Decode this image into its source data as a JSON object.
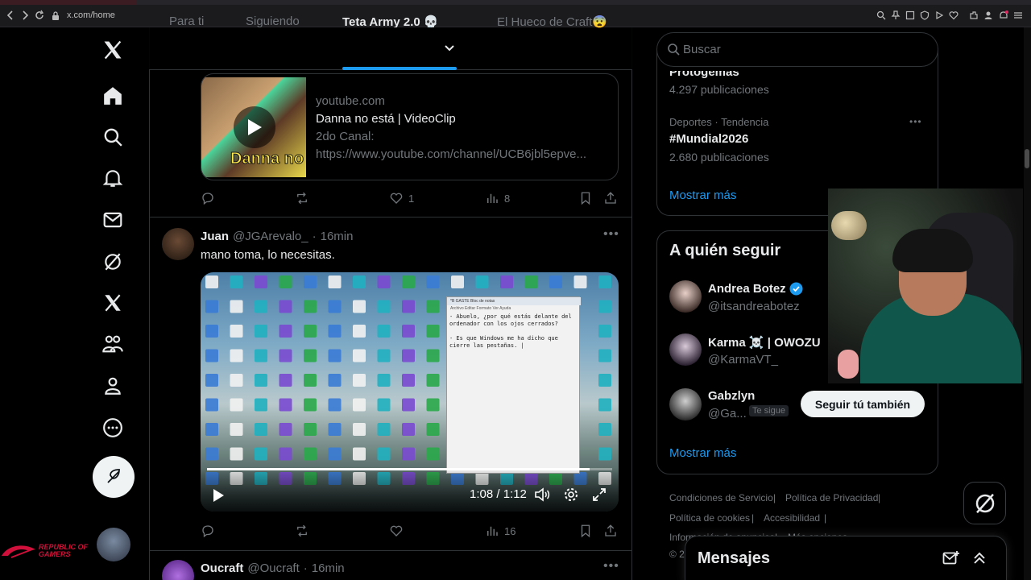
{
  "browser": {
    "url": "x.com/home"
  },
  "tabs": {
    "items": [
      "Para ti",
      "Siguiendo",
      "Teta Army 2.0 💀",
      "El Hueco de Craft😨"
    ]
  },
  "card": {
    "domain": "youtube.com",
    "title": "Danna no está | VideoClip",
    "desc_line1": "2do Canal:",
    "desc_line2": "https://www.youtube.com/channel/UCB6jbl5epve...",
    "thumb_text": "Danna no",
    "likes": "1",
    "views": "8"
  },
  "tweet1": {
    "name": "Juan",
    "handle": "@JGArevalo_",
    "time": "16min",
    "text": "mano toma, lo necesitas.",
    "views": "16",
    "video": {
      "time": "1:08 / 1:12",
      "progress": 0.944,
      "notepad_title": "*B GASTE Bloc de notas",
      "notepad_menu": "Archivo  Editar  Formato  Ver  Ayuda",
      "notepad_text": "- Abuelo, ¿por qué estás delante del ordenador con los ojos cerrados?\n\n- Es que Windows me ha dicho que cierre las pestañas. |"
    }
  },
  "tweet2": {
    "name": "Oucraft",
    "handle": "@Oucraft",
    "time": "16min"
  },
  "search": {
    "placeholder": "Buscar"
  },
  "trends": {
    "partial_name": "Protogemas",
    "partial_count": "4.297 publicaciones",
    "item_meta": "Deportes · Tendencia",
    "item_name": "#Mundial2026",
    "item_count": "2.680 publicaciones",
    "show_more": "Mostrar más"
  },
  "who_to_follow": {
    "title": "A quién seguir",
    "users": [
      {
        "name": "Andrea Botez",
        "handle": "@itsandreabotez",
        "verified": true
      },
      {
        "name": "Karma ☠️ | OWOZU",
        "handle": "@KarmaVT_"
      },
      {
        "name": "Gabzlyn",
        "handle": "@Ga...",
        "badge": "Te sigue",
        "button": "Seguir tú también"
      }
    ],
    "show_more": "Mostrar más"
  },
  "footer": {
    "links": [
      "Condiciones de Servicio",
      "Política de Privacidad",
      "Política de cookies",
      "Accesibilidad",
      "Información de anuncios",
      "Más opciones"
    ],
    "copyright": "© 2"
  },
  "messages": {
    "title": "Mensajes"
  },
  "rog": {
    "line1": "REPUBLIC OF",
    "line2": "GAMERS"
  },
  "colors": {
    "accent": "#1d9bf0",
    "background": "#000000",
    "border": "#2f3336",
    "muted": "#71767b"
  }
}
